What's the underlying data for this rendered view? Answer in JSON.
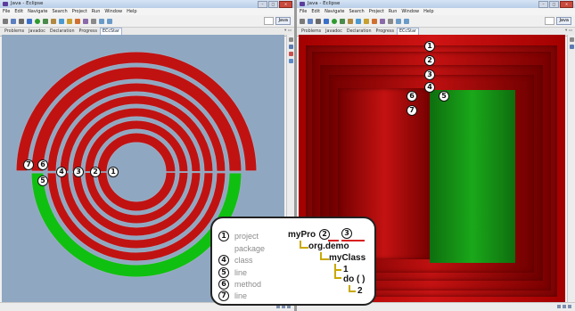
{
  "left_window": {
    "title": "Java - Eclipse",
    "menu": [
      "File",
      "Edit",
      "Navigate",
      "Search",
      "Project",
      "Run",
      "Window",
      "Help"
    ],
    "perspective": "Java",
    "tabs": [
      "Problems",
      "Javadoc",
      "Declaration",
      "Progress",
      "ECcStar"
    ]
  },
  "right_window": {
    "title": "Java - Eclipse",
    "menu": [
      "File",
      "Edit",
      "Navigate",
      "Search",
      "Project",
      "Run",
      "Window",
      "Help"
    ],
    "perspective": "Java",
    "tabs": [
      "Problems",
      "Javadoc",
      "Declaration",
      "Progress",
      "ECcStar"
    ]
  },
  "badges": [
    "1",
    "2",
    "3",
    "4",
    "5",
    "6",
    "7"
  ],
  "legend": {
    "rows": [
      {
        "num": "1",
        "label": "project"
      },
      {
        "num": "",
        "label": "package"
      },
      {
        "num": "4",
        "label": "class"
      },
      {
        "num": "5",
        "label": "line"
      },
      {
        "num": "6",
        "label": "method"
      },
      {
        "num": "7",
        "label": "line"
      }
    ],
    "tree": {
      "project": "myPro",
      "package": "org.demo",
      "class": "myClass",
      "line1": "1",
      "method": "do ( )",
      "line2": "2"
    }
  },
  "colors": {
    "ring_red": "#c11212",
    "ring_green": "#10c010",
    "view_bg": "#8fa7c1",
    "treemap_red": "#c81010",
    "treemap_green": "#129a12"
  }
}
